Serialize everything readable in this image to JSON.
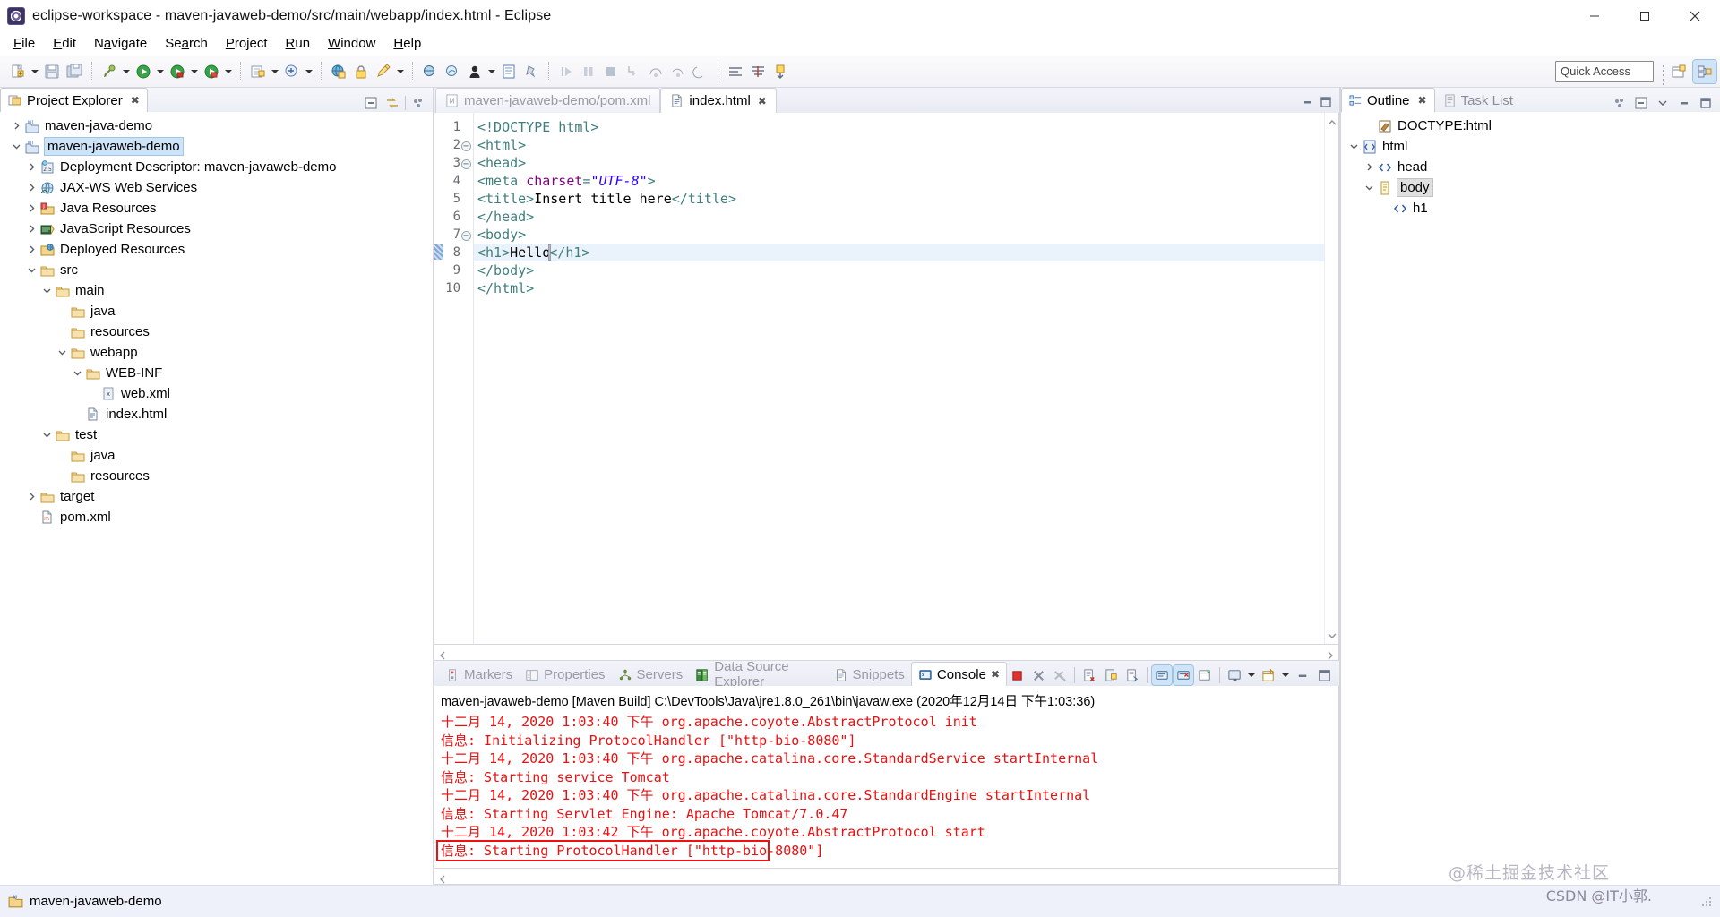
{
  "window": {
    "title": "eclipse-workspace - maven-javaweb-demo/src/main/webapp/index.html - Eclipse",
    "minimize": "–",
    "maximize": "❐",
    "close": "✕"
  },
  "menubar": {
    "items": [
      {
        "label": "File",
        "mnemonic": "F"
      },
      {
        "label": "Edit",
        "mnemonic": "E"
      },
      {
        "label": "Navigate",
        "mnemonic": "a"
      },
      {
        "label": "Search",
        "mnemonic": "a"
      },
      {
        "label": "Project",
        "mnemonic": "P"
      },
      {
        "label": "Run",
        "mnemonic": "R"
      },
      {
        "label": "Window",
        "mnemonic": "W"
      },
      {
        "label": "Help",
        "mnemonic": "H"
      }
    ]
  },
  "toolbar": {
    "quick_access_placeholder": "Quick Access",
    "groups": [
      [
        "new-wizard-icon",
        "save-icon",
        "save-all-icon"
      ],
      [
        "build-icon",
        "run-external-tools-icon",
        "debug-icon",
        "run-icon"
      ],
      [
        "new-java-package-icon",
        "new-java-class-icon"
      ],
      [
        "open-web-browser-icon",
        "lock-icon",
        "edit-icon"
      ],
      [
        "search-icon",
        "link-icon",
        "person-icon",
        "document-icon",
        "pin-icon"
      ],
      [
        "resume-icon",
        "suspend-icon",
        "terminate-icon",
        "step-into-icon",
        "step-over-icon",
        "step-return-icon",
        "drop-to-frame-icon"
      ],
      [
        "open-type-icon",
        "open-task-icon",
        "download-icon"
      ]
    ],
    "perspective_new_label": "new-perspective-icon",
    "perspective_active_label": "java-ee-perspective-icon"
  },
  "project_explorer": {
    "tab_label": "Project Explorer",
    "tab_close": "✖",
    "actions": [
      "collapse-all-icon",
      "link-with-editor-icon",
      "view-menu-icon"
    ],
    "tree": [
      {
        "label": "maven-java-demo",
        "depth": 0,
        "twisty": "collapsed",
        "icon": "maven-project-icon",
        "selected": false
      },
      {
        "label": "maven-javaweb-demo",
        "depth": 0,
        "twisty": "expanded",
        "icon": "maven-project-icon",
        "selected": true
      },
      {
        "label": "Deployment Descriptor: maven-javaweb-demo",
        "depth": 1,
        "twisty": "collapsed",
        "icon": "deployment-descriptor-icon",
        "selected": false
      },
      {
        "label": "JAX-WS Web Services",
        "depth": 1,
        "twisty": "collapsed",
        "icon": "webservices-icon",
        "selected": false
      },
      {
        "label": "Java Resources",
        "depth": 1,
        "twisty": "collapsed",
        "icon": "java-resources-icon",
        "selected": false
      },
      {
        "label": "JavaScript Resources",
        "depth": 1,
        "twisty": "collapsed",
        "icon": "javascript-resources-icon",
        "selected": false
      },
      {
        "label": "Deployed Resources",
        "depth": 1,
        "twisty": "collapsed",
        "icon": "deployed-resources-icon",
        "selected": false
      },
      {
        "label": "src",
        "depth": 1,
        "twisty": "expanded",
        "icon": "folder-icon",
        "selected": false
      },
      {
        "label": "main",
        "depth": 2,
        "twisty": "expanded",
        "icon": "folder-icon",
        "selected": false
      },
      {
        "label": "java",
        "depth": 3,
        "twisty": "none",
        "icon": "folder-icon",
        "selected": false
      },
      {
        "label": "resources",
        "depth": 3,
        "twisty": "none",
        "icon": "folder-icon",
        "selected": false
      },
      {
        "label": "webapp",
        "depth": 3,
        "twisty": "expanded",
        "icon": "folder-icon",
        "selected": false
      },
      {
        "label": "WEB-INF",
        "depth": 4,
        "twisty": "expanded",
        "icon": "folder-icon",
        "selected": false
      },
      {
        "label": "web.xml",
        "depth": 5,
        "twisty": "none",
        "icon": "xml-file-icon",
        "selected": false
      },
      {
        "label": "index.html",
        "depth": 4,
        "twisty": "none",
        "icon": "html-file-icon",
        "selected": false
      },
      {
        "label": "test",
        "depth": 2,
        "twisty": "expanded",
        "icon": "folder-icon",
        "selected": false
      },
      {
        "label": "java",
        "depth": 3,
        "twisty": "none",
        "icon": "folder-icon",
        "selected": false
      },
      {
        "label": "resources",
        "depth": 3,
        "twisty": "none",
        "icon": "folder-icon",
        "selected": false
      },
      {
        "label": "target",
        "depth": 1,
        "twisty": "collapsed",
        "icon": "folder-icon",
        "selected": false
      },
      {
        "label": "pom.xml",
        "depth": 1,
        "twisty": "none",
        "icon": "maven-pom-icon",
        "selected": false
      }
    ]
  },
  "editor": {
    "tabs": [
      {
        "label": "maven-javaweb-demo/pom.xml",
        "icon": "maven-pom-icon",
        "active": false,
        "closable": false
      },
      {
        "label": "index.html",
        "icon": "html-file-icon",
        "active": true,
        "closable": true,
        "close": "✖"
      }
    ],
    "controls": [
      "minimize-icon",
      "maximize-icon"
    ],
    "lines": [
      {
        "n": "1",
        "fold": "",
        "html": "<span class=\"tag\">&lt;!DOCTYPE html&gt;</span>",
        "text": "<!DOCTYPE html>",
        "highlight": false
      },
      {
        "n": "2",
        "fold": "-",
        "html": "<span class=\"tag\">&lt;html&gt;</span>",
        "text": "<html>",
        "highlight": false
      },
      {
        "n": "3",
        "fold": "-",
        "html": "<span class=\"tag\">&lt;head&gt;</span>",
        "text": "<head>",
        "highlight": false
      },
      {
        "n": "4",
        "fold": "",
        "html": "<span class=\"tag\">&lt;meta </span><span class=\"attr\">charset</span><span class=\"tag\">=</span><span class=\"val\">\"UTF-8\"</span><span class=\"tag\">&gt;</span>",
        "text": "<meta charset=\"UTF-8\">",
        "highlight": false
      },
      {
        "n": "5",
        "fold": "",
        "html": "<span class=\"tag\">&lt;title&gt;</span>Insert title here<span class=\"tag\">&lt;/title&gt;</span>",
        "text": "<title>Insert title here</title>",
        "highlight": false
      },
      {
        "n": "6",
        "fold": "",
        "html": "<span class=\"tag\">&lt;/head&gt;</span>",
        "text": "</head>",
        "highlight": false
      },
      {
        "n": "7",
        "fold": "-",
        "html": "<span class=\"tag\">&lt;body&gt;</span>",
        "text": "<body>",
        "highlight": false
      },
      {
        "n": "8",
        "fold": "",
        "html": "<span class=\"tag\">&lt;h1&gt;</span>Hello<span class=\"curs\"></span><span class=\"tag\">&lt;/h1&gt;</span>",
        "text": "<h1>Hello</h1>",
        "highlight": true
      },
      {
        "n": "9",
        "fold": "",
        "html": "<span class=\"tag\">&lt;/body&gt;</span>",
        "text": "</body>",
        "highlight": false
      },
      {
        "n": "10",
        "fold": "",
        "html": "<span class=\"tag\">&lt;/html&gt;</span>",
        "text": "</html>",
        "highlight": false
      }
    ]
  },
  "console": {
    "tabs": [
      {
        "label": "Markers",
        "icon": "markers-icon",
        "active": false
      },
      {
        "label": "Properties",
        "icon": "properties-icon",
        "active": false
      },
      {
        "label": "Servers",
        "icon": "servers-icon",
        "active": false
      },
      {
        "label": "Data Source Explorer",
        "icon": "datasource-icon",
        "active": false
      },
      {
        "label": "Snippets",
        "icon": "snippets-icon",
        "active": false
      },
      {
        "label": "Console",
        "icon": "console-icon",
        "active": true,
        "close": "✖"
      }
    ],
    "tools": [
      {
        "name": "terminate-icon",
        "on": false
      },
      {
        "name": "remove-launch-icon",
        "on": false
      },
      {
        "name": "remove-all-terminated-icon",
        "on": false
      },
      {
        "name": "clear-console-icon",
        "on": false
      },
      {
        "name": "scroll-lock-icon",
        "on": false
      },
      {
        "name": "word-wrap-icon",
        "on": false
      },
      {
        "name": "show-console-on-output-icon",
        "on": true
      },
      {
        "name": "show-console-on-error-icon",
        "on": true
      },
      {
        "name": "pin-console-icon",
        "on": false
      },
      {
        "name": "display-selected-console-icon",
        "on": false
      },
      {
        "name": "open-console-icon",
        "on": false
      },
      {
        "name": "minimize-icon",
        "on": false
      },
      {
        "name": "maximize-icon",
        "on": false
      }
    ],
    "header": "maven-javaweb-demo [Maven Build] C:\\DevTools\\Java\\jre1.8.0_261\\bin\\javaw.exe (2020年12月14日 下午1:03:36)",
    "lines": [
      {
        "text": "十二月 14, 2020 1:03:40 下午 org.apache.coyote.AbstractProtocol init",
        "boxed": false
      },
      {
        "text": "信息: Initializing ProtocolHandler [\"http-bio-8080\"]",
        "boxed": false
      },
      {
        "text": "十二月 14, 2020 1:03:40 下午 org.apache.catalina.core.StandardService startInternal",
        "boxed": false
      },
      {
        "text": "信息: Starting service Tomcat",
        "boxed": false
      },
      {
        "text": "十二月 14, 2020 1:03:40 下午 org.apache.catalina.core.StandardEngine startInternal",
        "boxed": false
      },
      {
        "text": "信息: Starting Servlet Engine: Apache Tomcat/7.0.47",
        "boxed": false
      },
      {
        "text": "十二月 14, 2020 1:03:42 下午 org.apache.coyote.AbstractProtocol start",
        "boxed": false
      },
      {
        "text": "信息: Starting ProtocolHandler [\"http-bio-8080\"]",
        "boxed": true
      }
    ],
    "highlight_color": "#f01010",
    "text_color": "#e81010"
  },
  "outline": {
    "tabs": [
      {
        "label": "Outline",
        "icon": "outline-icon",
        "active": true,
        "close": "✖"
      },
      {
        "label": "Task List",
        "icon": "tasklist-icon",
        "active": false
      }
    ],
    "actions": [
      "sort-icon",
      "collapse-all-icon",
      "view-menu-icon",
      "minimize-icon",
      "maximize-icon"
    ],
    "tree": [
      {
        "label": "DOCTYPE:html",
        "depth": 1,
        "twisty": "none",
        "icon": "doctype-icon",
        "selected": false
      },
      {
        "label": "html",
        "depth": 0,
        "twisty": "expanded",
        "icon": "html-tag-icon",
        "selected": false
      },
      {
        "label": "head",
        "depth": 1,
        "twisty": "collapsed",
        "icon": "angle-tag-icon",
        "selected": false
      },
      {
        "label": "body",
        "depth": 1,
        "twisty": "expanded",
        "icon": "body-tag-icon",
        "selected": true
      },
      {
        "label": "h1",
        "depth": 2,
        "twisty": "none",
        "icon": "angle-tag-icon",
        "selected": false
      }
    ]
  },
  "statusbar": {
    "icon": "maven-project-icon",
    "label": "maven-javaweb-demo"
  },
  "watermarks": {
    "primary": "@稀土掘金技术社区",
    "secondary": "CSDN @IT小郭."
  },
  "colors": {
    "selection_blue": "#cde3f7",
    "console_red": "#e81010",
    "tag_teal": "#3f7f7f",
    "attr_purple": "#7f007f",
    "value_blue": "#2a00ff",
    "active_tool_blue": "#cfe4f7"
  }
}
